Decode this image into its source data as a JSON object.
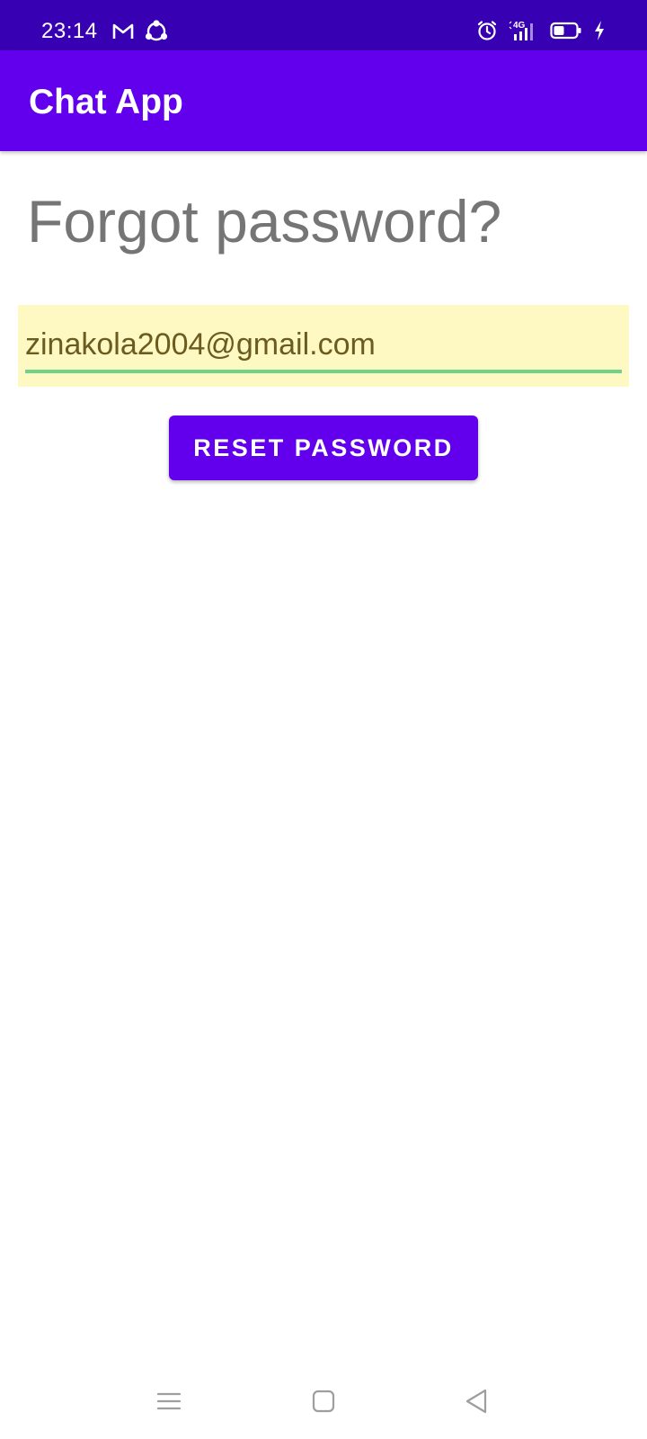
{
  "status_bar": {
    "time": "23:14",
    "icons": [
      "gmail-icon",
      "sync-icon",
      "alarm-icon",
      "signal-4g-icon",
      "battery-icon",
      "charging-icon"
    ],
    "network_label": "4G"
  },
  "app_bar": {
    "title": "Chat App"
  },
  "form": {
    "heading": "Forgot password?",
    "email_value": "zinakola2004@gmail.com",
    "reset_button_label": "RESET PASSWORD"
  },
  "nav_bar": {
    "icons": [
      "menu-icon",
      "home-icon",
      "back-icon"
    ]
  },
  "colors": {
    "status_bar": "#3700b3",
    "primary": "#6200ee",
    "field_background": "#fef9c3",
    "field_underline": "#6fd38a",
    "heading_text": "#757575"
  }
}
